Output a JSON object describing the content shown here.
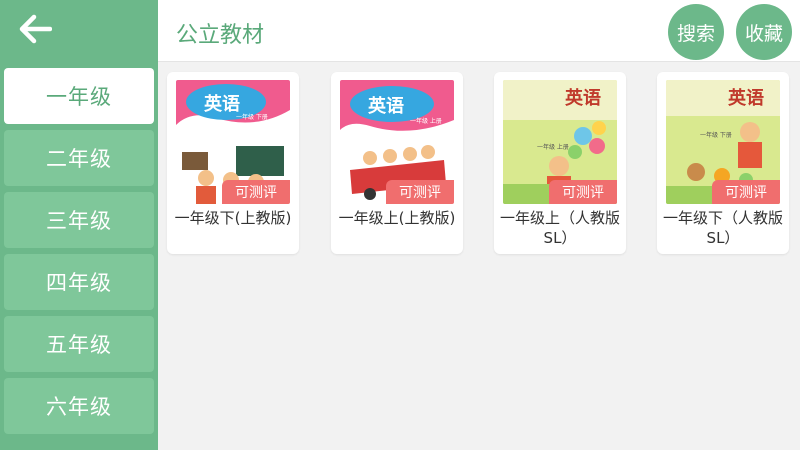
{
  "sidebar": {
    "back_icon": "arrow-left-icon",
    "grades": [
      {
        "label": "一年级",
        "active": true
      },
      {
        "label": "二年级",
        "active": false
      },
      {
        "label": "三年级",
        "active": false
      },
      {
        "label": "四年级",
        "active": false
      },
      {
        "label": "五年级",
        "active": false
      },
      {
        "label": "六年级",
        "active": false
      }
    ]
  },
  "header": {
    "title": "公立教材",
    "search_label": "搜索",
    "favorites_label": "收藏"
  },
  "books": [
    {
      "title": "一年级下(上教版)",
      "badge": "可测评",
      "cover_title": "英语",
      "cover_sub": "一年级 下册"
    },
    {
      "title": "一年级上(上教版)",
      "badge": "可测评",
      "cover_title": "英语",
      "cover_sub": "一年级 上册"
    },
    {
      "title": "一年级上（人教版SL）",
      "badge": "可测评",
      "cover_title": "英语",
      "cover_sub": "一年级 上册"
    },
    {
      "title": "一年级下（人教版SL）",
      "badge": "可测评",
      "cover_title": "英语",
      "cover_sub": "一年级 下册"
    }
  ],
  "colors": {
    "primary": "#6cb88a",
    "active_text": "#5aa97a",
    "badge": "#f06e6e"
  }
}
